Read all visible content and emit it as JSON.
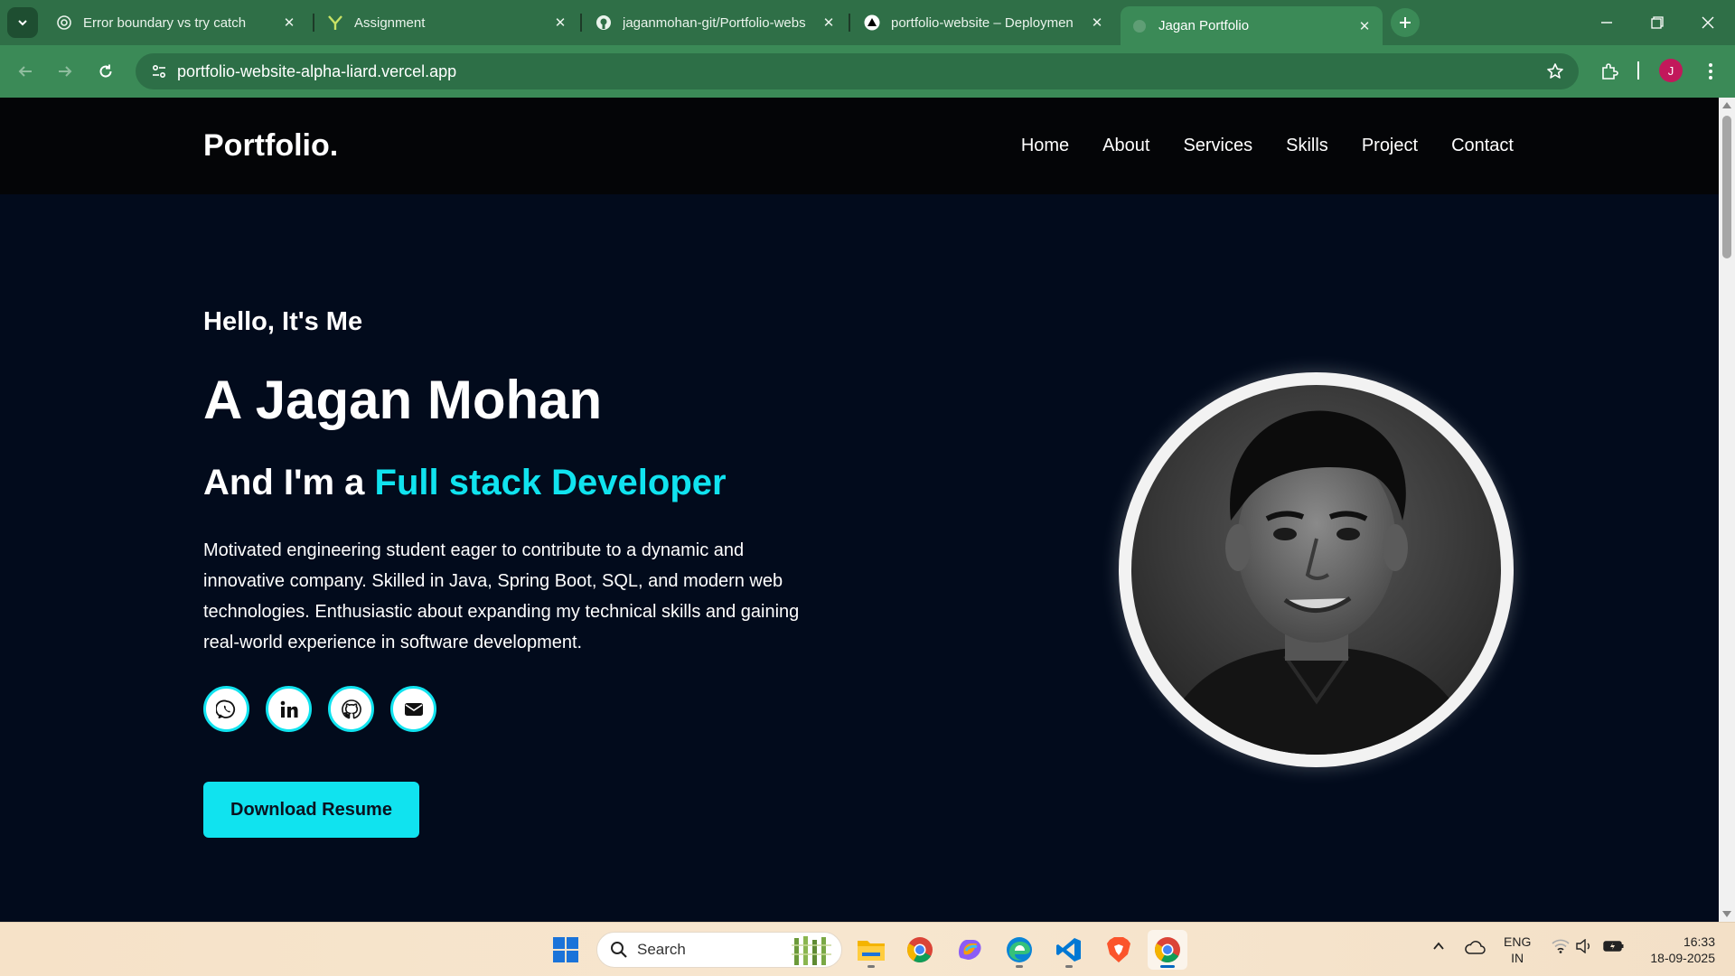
{
  "browser": {
    "tabs": [
      {
        "title": "Error boundary vs try catch",
        "favicon": "openai-icon"
      },
      {
        "title": "Assignment",
        "favicon": "brand-y-icon"
      },
      {
        "title": "jaganmohan-git/Portfolio-webs",
        "favicon": "github-icon"
      },
      {
        "title": "portfolio-website – Deploymen",
        "favicon": "vercel-icon"
      },
      {
        "title": "Jagan Portfolio",
        "favicon": "globe-icon",
        "active": true
      }
    ],
    "url": "portfolio-website-alpha-liard.vercel.app",
    "profile_initial": "J",
    "theme_color": "#3b8a57"
  },
  "site": {
    "logo": "Portfolio.",
    "nav": [
      "Home",
      "About",
      "Services",
      "Skills",
      "Project",
      "Contact"
    ],
    "hero": {
      "greeting": "Hello, It's Me",
      "name": "A Jagan Mohan",
      "role_prefix": "And I'm a",
      "role_highlight": "Full stack Developer",
      "bio": "Motivated engineering student eager to contribute to a dynamic and innovative company. Skilled in Java, Spring Boot, SQL, and modern web technologies. Enthusiastic about expanding my technical skills and gaining real-world experience in software development.",
      "socials": [
        "whatsapp-icon",
        "linkedin-icon",
        "github-icon",
        "mail-icon"
      ],
      "cta": "Download Resume"
    },
    "accent_color": "#10e3ef",
    "background_color": "#020b1c"
  },
  "taskbar": {
    "search_placeholder": "Search",
    "apps": [
      "windows-start-icon",
      "file-explorer-icon",
      "chrome-icon",
      "copilot-icon",
      "edge-icon",
      "vscode-icon",
      "brave-icon",
      "chrome-active-icon"
    ],
    "lang_top": "ENG",
    "lang_bottom": "IN",
    "time": "16:33",
    "date": "18-09-2025"
  }
}
